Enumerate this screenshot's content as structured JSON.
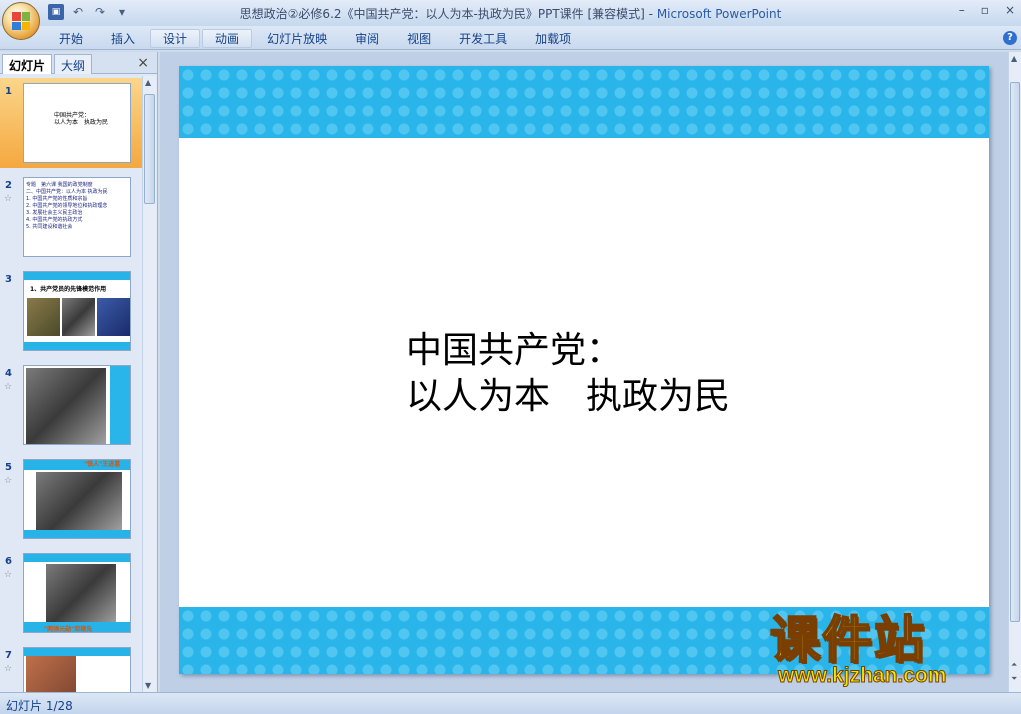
{
  "window": {
    "title": "思想政治②必修6.2《中国共产党：以人为本-执政为民》PPT课件 [兼容模式]",
    "app_name": "Microsoft PowerPoint",
    "controls": [
      "–",
      "▫",
      "×"
    ]
  },
  "ribbon": {
    "tabs": [
      "开始",
      "插入",
      "设计",
      "动画",
      "幻灯片放映",
      "审阅",
      "视图",
      "开发工具",
      "加载项"
    ]
  },
  "pane": {
    "tab_slides": "幻灯片",
    "tab_outline": "大纲",
    "close": "×"
  },
  "thumbnails": [
    {
      "num": "1",
      "text": "中国共产党：\n以人为本　执政为民",
      "selected": true
    },
    {
      "num": "2",
      "text": "专题　第六课 我国的政党制度\n二、中国共产党：以人为本 执政为民\n1. 中国共产党的性质和宗旨\n2. 中国共产党的领导地位和执政理念\n3. 发展社会主义民主政治\n4. 中国共产党的执政方式\n5. 共同建设和谐社会",
      "selected": false
    },
    {
      "num": "3",
      "text": "1、共产党员的先锋模范作用",
      "selected": false
    },
    {
      "num": "4",
      "text": "",
      "selected": false
    },
    {
      "num": "5",
      "text": "\"铁人\"王进喜",
      "selected": false
    },
    {
      "num": "6",
      "text": "\"两弹元勋\"邓稼先",
      "selected": false
    },
    {
      "num": "7",
      "text": "",
      "selected": false
    }
  ],
  "slide": {
    "title_line1": "中国共产党：",
    "title_line2": "以人为本　执政为民",
    "band_color": "#29b5ea"
  },
  "status": {
    "text": "幻灯片 1/28"
  },
  "watermark": {
    "main": "课件站",
    "url": "www.kjzhan.com"
  }
}
